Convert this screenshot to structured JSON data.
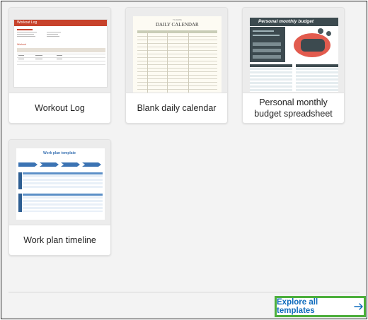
{
  "templates": [
    {
      "label": "Workout Log",
      "thumb_title": "Workout Log",
      "thumb_section": "Workout"
    },
    {
      "label": "Blank daily calendar",
      "thumb_title": "DAILY CALENDAR",
      "thumb_kicker": "TO-DATE"
    },
    {
      "label": "Personal monthly budget spreadsheet",
      "thumb_title": "Personal monthly budget"
    },
    {
      "label": "Work plan timeline",
      "thumb_title": "Work plan template"
    }
  ],
  "footer": {
    "explore_label": "Explore all templates",
    "explore_icon": "arrow-right-icon"
  },
  "colors": {
    "accent_link": "#0f6cbd",
    "highlight_border": "#4caf3c",
    "workout_red": "#c7422b",
    "budget_dark": "#3c4a4f",
    "workplan_blue": "#3b73b3"
  }
}
